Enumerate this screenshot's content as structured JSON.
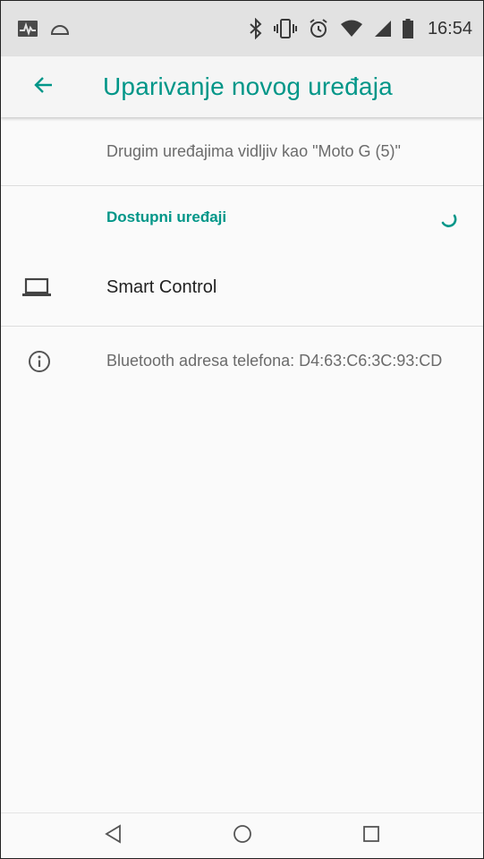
{
  "status_bar": {
    "time": "16:54",
    "left_icons": [
      "pulse-app-icon",
      "cloud-icon"
    ],
    "right_icons": [
      "bluetooth-icon",
      "vibrate-icon",
      "alarm-icon",
      "wifi-icon",
      "cell-signal-icon",
      "battery-icon"
    ]
  },
  "toolbar": {
    "back_icon": "arrow-back-icon",
    "title": "Uparivanje novog uređaja"
  },
  "content": {
    "visible_as": "Drugim uređajima vidljiv kao \"Moto G (5)\"",
    "available_section": {
      "title": "Dostupni uređaji",
      "spinner_icon": "loading-spinner-icon"
    },
    "devices": [
      {
        "name": "Smart Control",
        "icon": "laptop-icon"
      }
    ],
    "info": {
      "icon": "info-icon",
      "text": "Bluetooth adresa telefona: D4:63:C6:3C:93:CD"
    }
  },
  "nav_bar": {
    "back_icon": "nav-back-icon",
    "home_icon": "nav-home-icon",
    "recents_icon": "nav-recents-icon"
  },
  "colors": {
    "accent": "#009688",
    "status_bar_bg": "#e2e2e2",
    "background": "#fafafa",
    "primary_text": "#212121",
    "secondary_text": "#6b6b6b"
  }
}
